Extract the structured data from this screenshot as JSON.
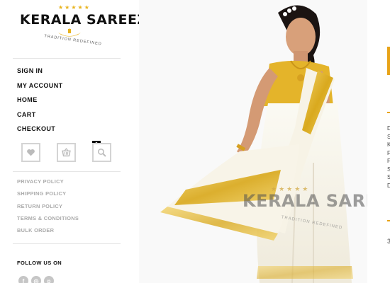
{
  "logo": {
    "brand": "KERALA SAREEZ",
    "tagline": "TRADITION REDEFINED",
    "stars": "★★★★★"
  },
  "nav": {
    "items": [
      "SIGN IN",
      "MY ACCOUNT",
      "HOME",
      "CART",
      "CHECKOUT"
    ]
  },
  "icons": {
    "wishlist": "heart-icon",
    "cart": "basket-icon",
    "search": "search-icon",
    "cart_count": "0"
  },
  "footer_links": [
    "PRIVACY POLICY",
    "SHIPPING POLICY",
    "RETURN POLICY",
    "TERMS & CONDITIONS",
    "BULK ORDER"
  ],
  "social": {
    "heading": "FOLLOW US ON",
    "icons": [
      {
        "name": "facebook-icon",
        "glyph": "f"
      },
      {
        "name": "instagram-icon",
        "glyph": "◎"
      },
      {
        "name": "pinterest-icon",
        "glyph": "p"
      }
    ]
  },
  "product_image": {
    "watermark": "KERALA SAREEZ",
    "watermark_tagline": "TRADITION REDEFINED",
    "watermark_stars": "★★★★★"
  },
  "right_column": {
    "cutoff_letters": [
      "D",
      "S",
      "K",
      "F",
      "F",
      "S",
      "S",
      "D"
    ],
    "cutoff_tail": "3"
  },
  "colors": {
    "accent_gold": "#e8a317",
    "saree_cream": "#f4f1e6",
    "kasavu_gold": "#d9a91e"
  }
}
